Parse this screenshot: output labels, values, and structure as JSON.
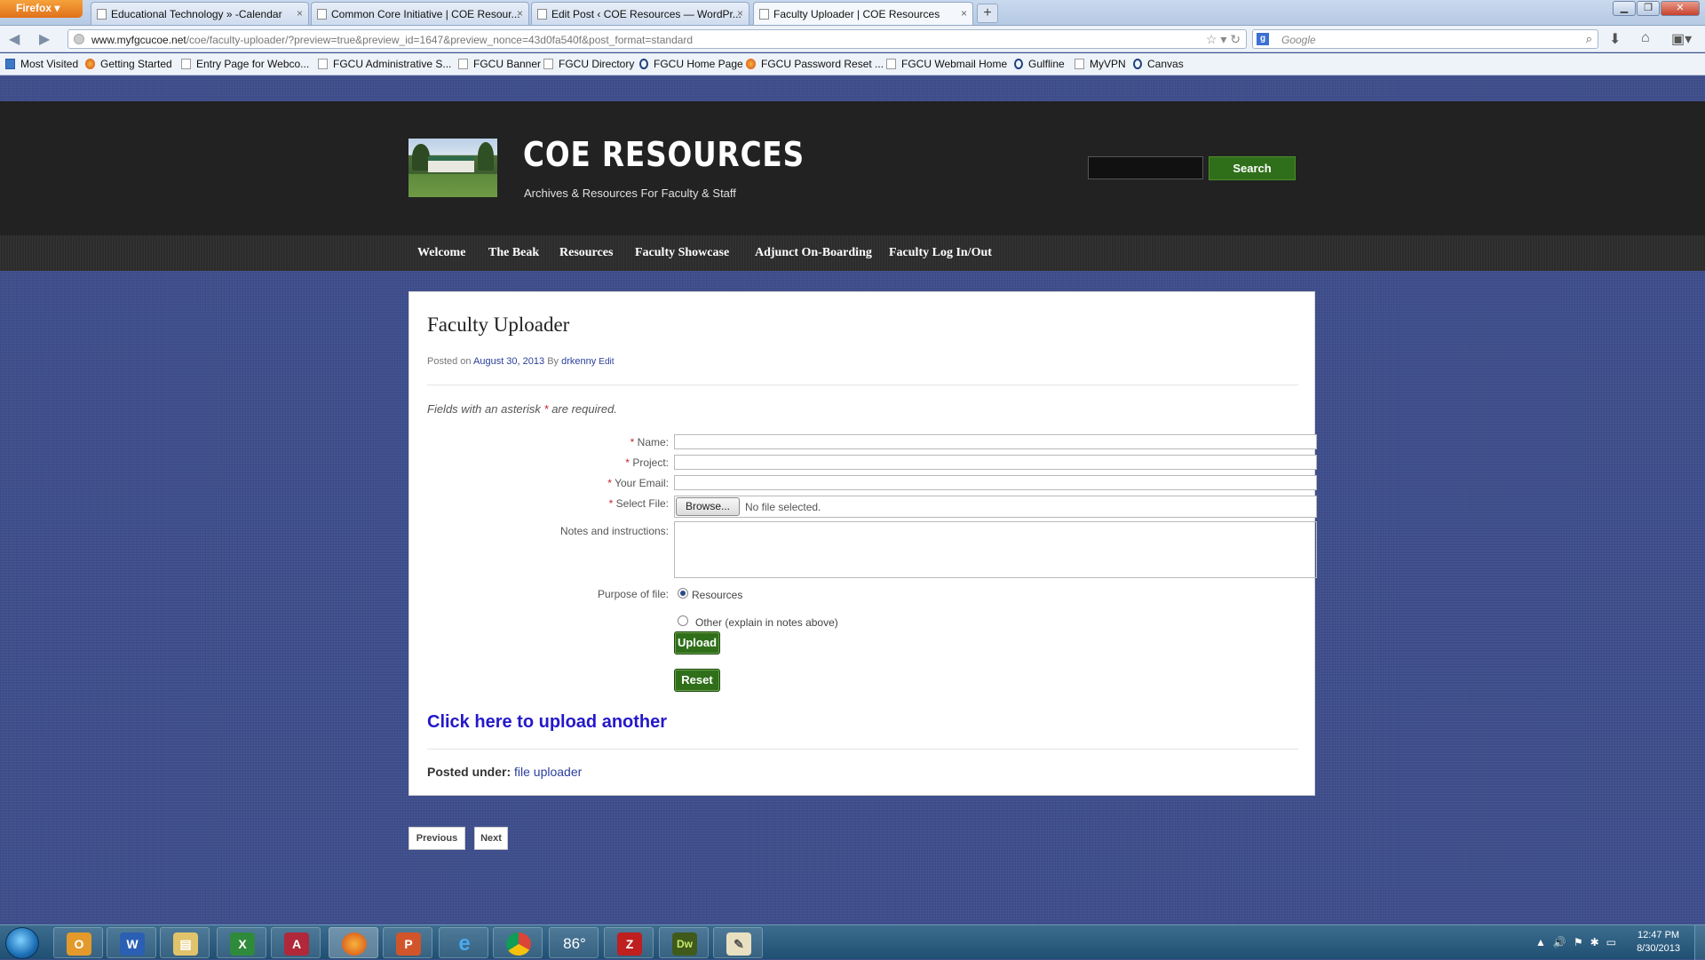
{
  "browser": {
    "menu_button": "Firefox",
    "tabs": [
      {
        "title": "Educational Technology » -Calendar"
      },
      {
        "title": "Common Core Initiative | COE Resour..."
      },
      {
        "title": "Edit Post ‹ COE Resources — WordPr..."
      },
      {
        "title": "Faculty Uploader | COE Resources"
      }
    ],
    "new_tab": "+",
    "url_host": "www.myfgcucoe.net",
    "url_path": "/coe/faculty-uploader/?preview=true&preview_id=1647&preview_nonce=43d0fa540f&post_format=standard",
    "search_engine_placeholder": "Google",
    "bookmarks": [
      "Most Visited",
      "Getting Started",
      "Entry Page for Webco...",
      "FGCU Administrative S...",
      "FGCU Banner",
      "FGCU Directory",
      "FGCU Home Page",
      "FGCU Password Reset ...",
      "FGCU Webmail Home",
      "Gulfline",
      "MyVPN",
      "Canvas"
    ]
  },
  "site": {
    "title": "COE RESOURCES",
    "description": "Archives & Resources For Faculty & Staff",
    "search_button": "Search",
    "menu": [
      "Welcome",
      "The Beak",
      "Resources",
      "Faculty Showcase",
      "Adjunct On-Boarding",
      "Faculty Log In/Out"
    ]
  },
  "post": {
    "title": "Faculty Uploader",
    "meta_prefix": "Posted on",
    "date": "August 30, 2013",
    "by": "By",
    "author": "drkenny",
    "edit": "Edit",
    "required_note_pre": "Fields with an asterisk",
    "required_note_star": "*",
    "required_note_post": "are required.",
    "form": {
      "name_label": "Name:",
      "project_label": "Project:",
      "email_label": "Your Email:",
      "file_label": "Select File:",
      "browse_button": "Browse...",
      "no_file": "No file selected.",
      "notes_label": "Notes and instructions:",
      "purpose_label": "Purpose of file:",
      "purpose_options": [
        "Resources",
        "Other (explain in notes above)"
      ],
      "purpose_selected": "Resources",
      "upload_button": "Upload",
      "reset_button": "Reset"
    },
    "upload_another": "Click here to upload another",
    "posted_under_label": "Posted under:",
    "category": "file uploader"
  },
  "pager": {
    "previous": "Previous",
    "next": "Next"
  },
  "taskbar": {
    "apps": [
      "Outlook",
      "Word",
      "File Explorer",
      "Excel",
      "Access",
      "Firefox",
      "PowerPoint",
      "Internet Explorer",
      "Chrome",
      "86°",
      "FileZilla",
      "Dreamweaver",
      "Paint"
    ],
    "time": "12:47 PM",
    "date": "8/30/2013"
  },
  "colors": {
    "accent_green": "#2f6f1a",
    "link_blue": "#2418c9",
    "page_bg": "#3f4f8d",
    "required_red": "#c0282d"
  }
}
